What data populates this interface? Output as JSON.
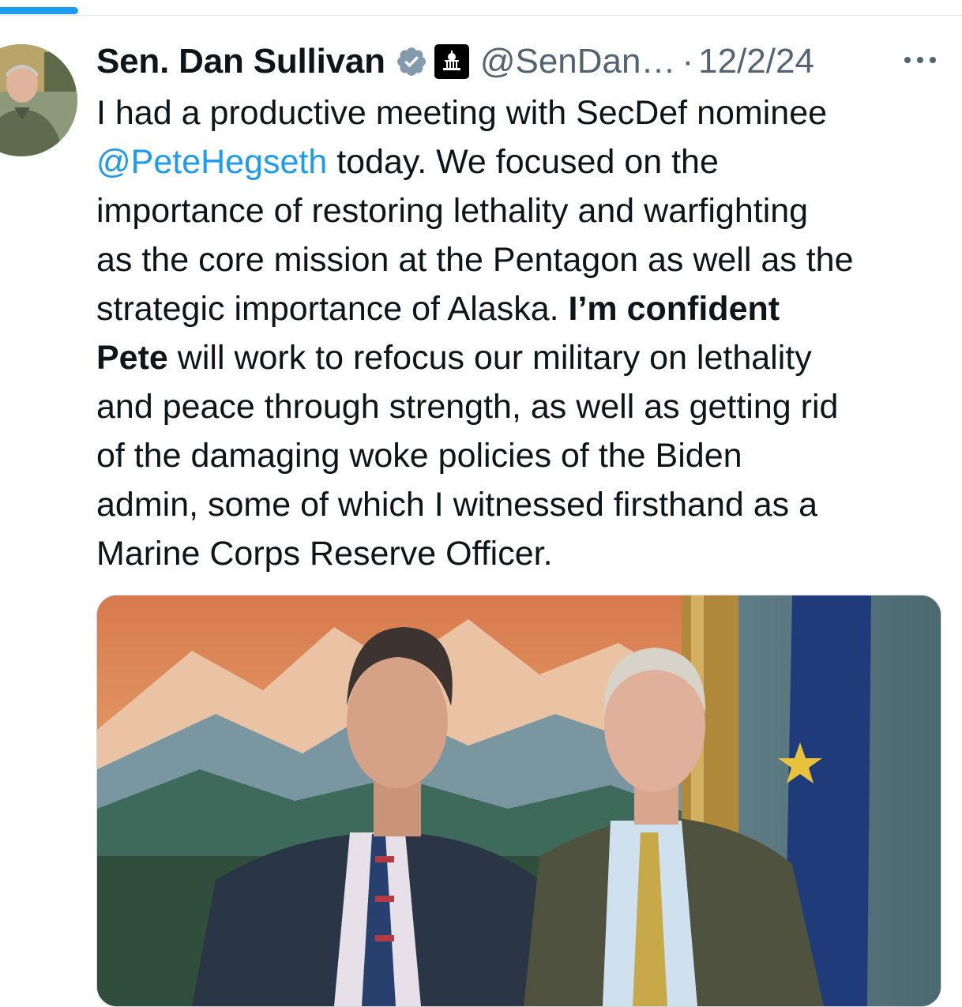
{
  "tweet": {
    "author": {
      "display_name": "Sen. Dan Sullivan",
      "handle": "@SenDan…",
      "verified_badge": "blue-check-icon",
      "affiliation_badge": "government-capitol-icon"
    },
    "separator": "·",
    "timestamp": "12/2/24",
    "more_menu_icon": "ellipsis-icon",
    "text": {
      "l1_a": "I had a productive meeting with SecDef nominee",
      "l2_mention": "@PeteHegseth",
      "l2_b": " today. We focused on the",
      "l3": "importance of restoring lethality and warfighting",
      "l4": "as the core mission at the Pentagon as well as the",
      "l5_a": "strategic importance of Alaska. ",
      "l5_bold": "I’m confident",
      "l6_bold": "Pete",
      "l6_b": " will work to refocus our military on lethality",
      "l7": "and peace through strength, as well as getting rid",
      "l8": "of the damaging woke policies of the Biden",
      "l9": "admin, some of which I witnessed firsthand as a",
      "l10": "Marine Corps Reserve Officer."
    },
    "media": {
      "description_icon": "photo-two-men-in-suits"
    }
  },
  "colors": {
    "link": "#1d9bf0",
    "secondary_text": "#536471",
    "primary_text": "#0f1419",
    "verified": "#829aab"
  }
}
